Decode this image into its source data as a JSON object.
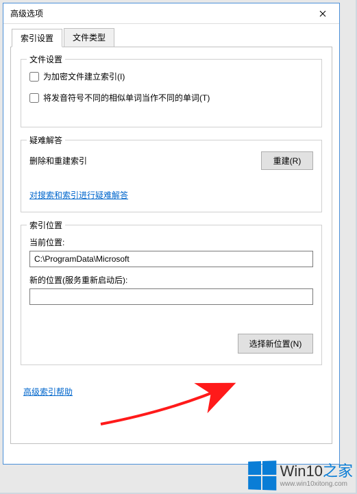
{
  "window": {
    "title": "高级选项"
  },
  "tabs": {
    "tab1": "索引设置",
    "tab2": "文件类型"
  },
  "file_settings": {
    "group_title": "文件设置",
    "encrypt_label": "为加密文件建立索引(I)",
    "encrypt_checked": false,
    "diacritics_label": "将发音符号不同的相似单词当作不同的单词(T)",
    "diacritics_checked": false
  },
  "troubleshoot": {
    "group_title": "疑难解答",
    "delete_label": "删除和重建索引",
    "rebuild_btn": "重建(R)",
    "help_link": "对搜索和索引进行疑难解答"
  },
  "index_location": {
    "group_title": "索引位置",
    "current_label": "当前位置:",
    "current_value": "C:\\ProgramData\\Microsoft",
    "new_label": "新的位置(服务重新启动后):",
    "new_value": "",
    "choose_btn": "选择新位置(N)"
  },
  "footer": {
    "help_link": "高级索引帮助"
  },
  "watermark": {
    "text_prefix": "Win10",
    "text_suffix": "之家",
    "url": "www.win10xitong.com"
  }
}
